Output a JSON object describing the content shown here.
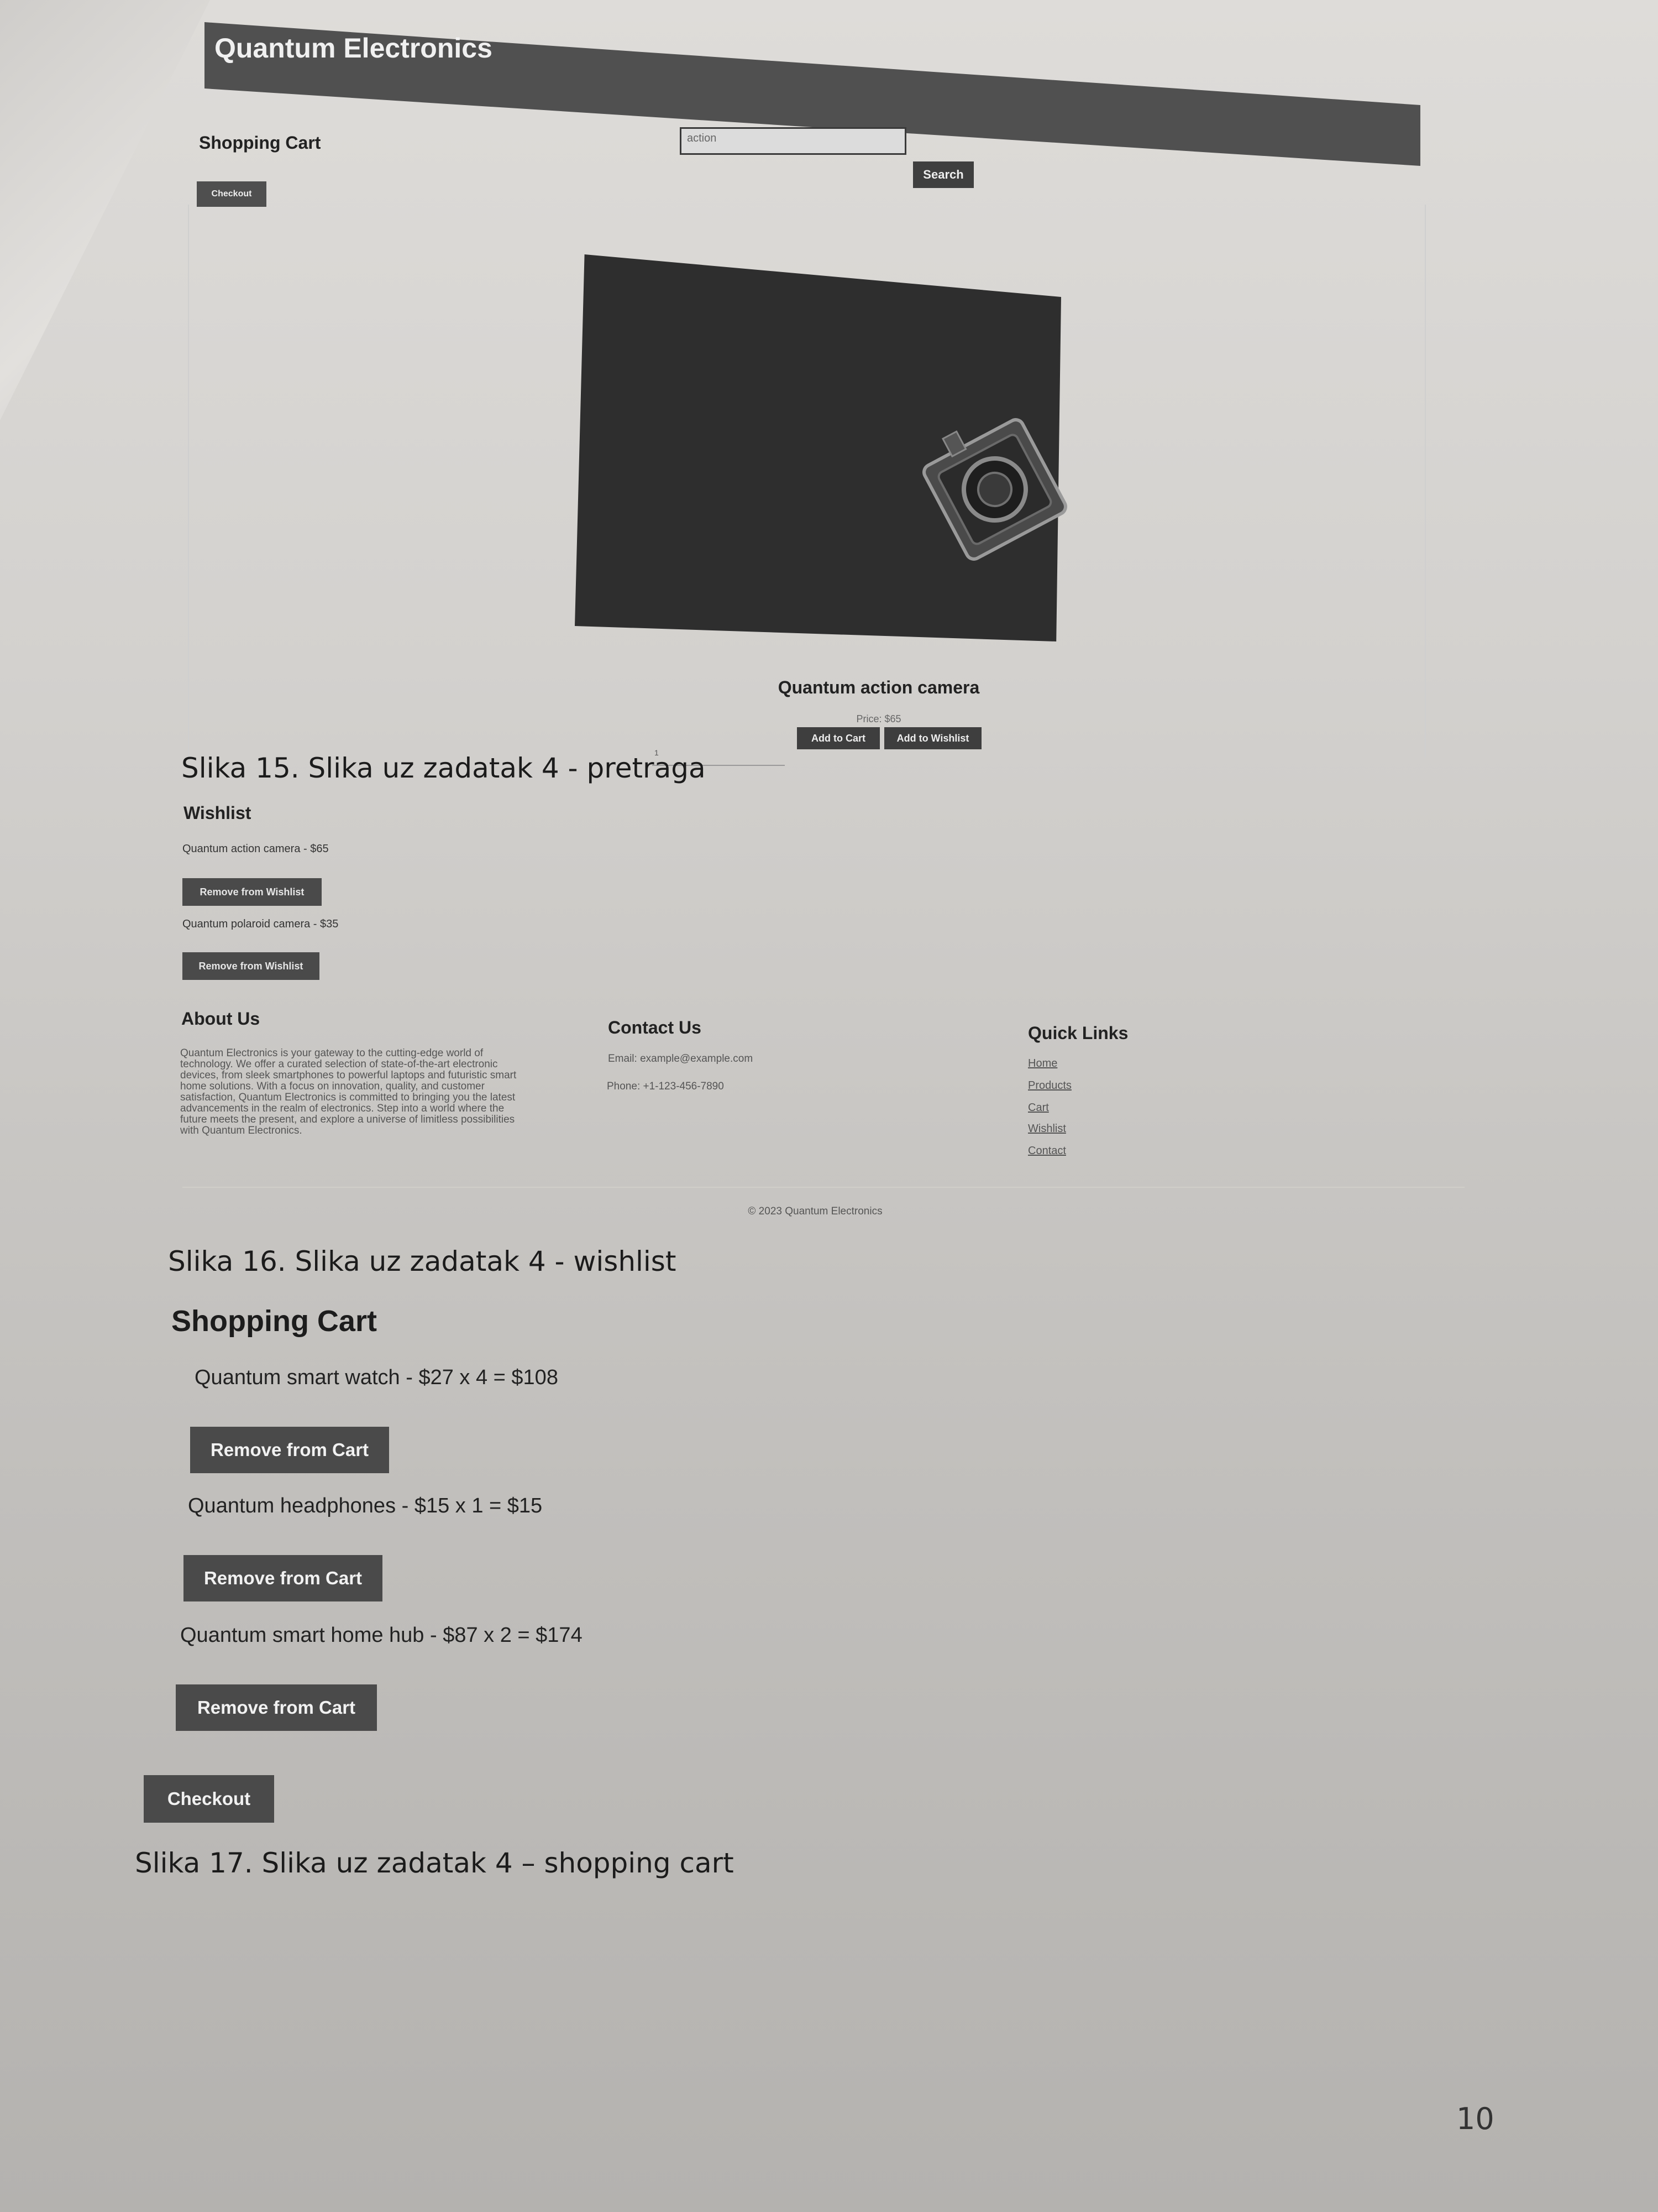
{
  "search_page": {
    "site_title": "Quantum Electronics",
    "cart_heading": "Shopping Cart",
    "checkout_label": "Checkout",
    "search_value": "action",
    "search_button": "Search",
    "product": {
      "name": "Quantum action camera",
      "price": "Price: $65",
      "quantity": "1",
      "add_to_cart": "Add to Cart",
      "add_to_wishlist": "Add to Wishlist"
    }
  },
  "captions": {
    "search": "Slika 15. Slika uz zadatak 4 - pretraga",
    "wishlist": "Slika 16. Slika uz zadatak 4 - wishlist",
    "cart": "Slika 17. Slika uz zadatak 4 – shopping cart"
  },
  "wishlist_page": {
    "heading": "Wishlist",
    "items": [
      {
        "text": "Quantum action camera - $65",
        "button": "Remove from Wishlist"
      },
      {
        "text": "Quantum polaroid camera - $35",
        "button": "Remove from Wishlist"
      }
    ],
    "footer": {
      "about_heading": "About Us",
      "about_lines": [
        "Quantum Electronics is your gateway to the cutting-edge world of",
        "technology. We offer a curated selection of state-of-the-art electronic",
        "devices, from sleek smartphones to powerful laptops and futuristic smart",
        "home solutions. With a focus on innovation, quality, and customer",
        "satisfaction, Quantum Electronics is committed to bringing you the latest",
        "advancements in the realm of electronics. Step into a world where the",
        "future meets the present, and explore a universe of limitless possibilities",
        "with Quantum Electronics."
      ],
      "contact_heading": "Contact Us",
      "email": "Email: example@example.com",
      "phone": "Phone: +1-123-456-7890",
      "links_heading": "Quick Links",
      "links": [
        "Home",
        "Products",
        "Cart",
        "Wishlist",
        "Contact"
      ],
      "copyright": "© 2023 Quantum Electronics"
    }
  },
  "cart_page": {
    "title": "Shopping Cart",
    "items": [
      {
        "text": "Quantum smart watch - $27 x 4 = $108",
        "button": "Remove from Cart"
      },
      {
        "text": "Quantum headphones - $15 x 1 = $15",
        "button": "Remove from Cart"
      },
      {
        "text": "Quantum smart home hub - $87 x 2 = $174",
        "button": "Remove from Cart"
      }
    ],
    "checkout": "Checkout"
  },
  "page_number": "10"
}
